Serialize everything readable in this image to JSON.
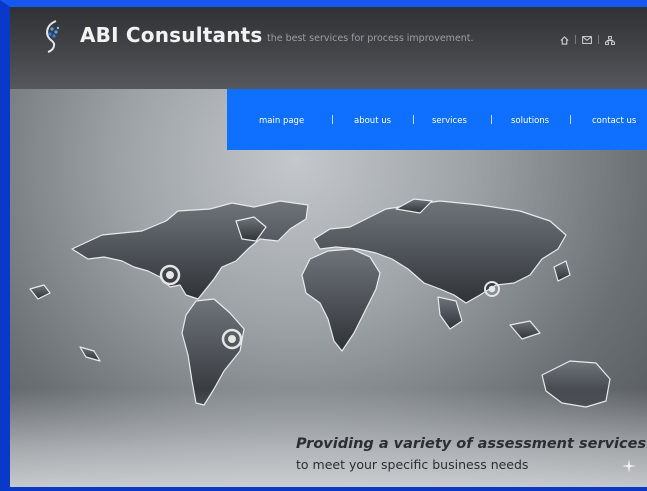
{
  "header": {
    "brand": "ABI Consultants",
    "tagline": "the best services for process improvement.",
    "icons": [
      "home-icon",
      "mail-icon",
      "sitemap-icon"
    ]
  },
  "nav": {
    "items": [
      {
        "label": "main page"
      },
      {
        "label": "about us"
      },
      {
        "label": "services"
      },
      {
        "label": "solutions"
      },
      {
        "label": "contact us"
      }
    ],
    "separator": "|"
  },
  "hero": {
    "heading": "Providing a variety of assessment services",
    "subheading": "to meet your specific business needs"
  },
  "colors": {
    "frame": "#0a39c9",
    "nav": "#0f6fff",
    "header": "#3a3c3f"
  }
}
